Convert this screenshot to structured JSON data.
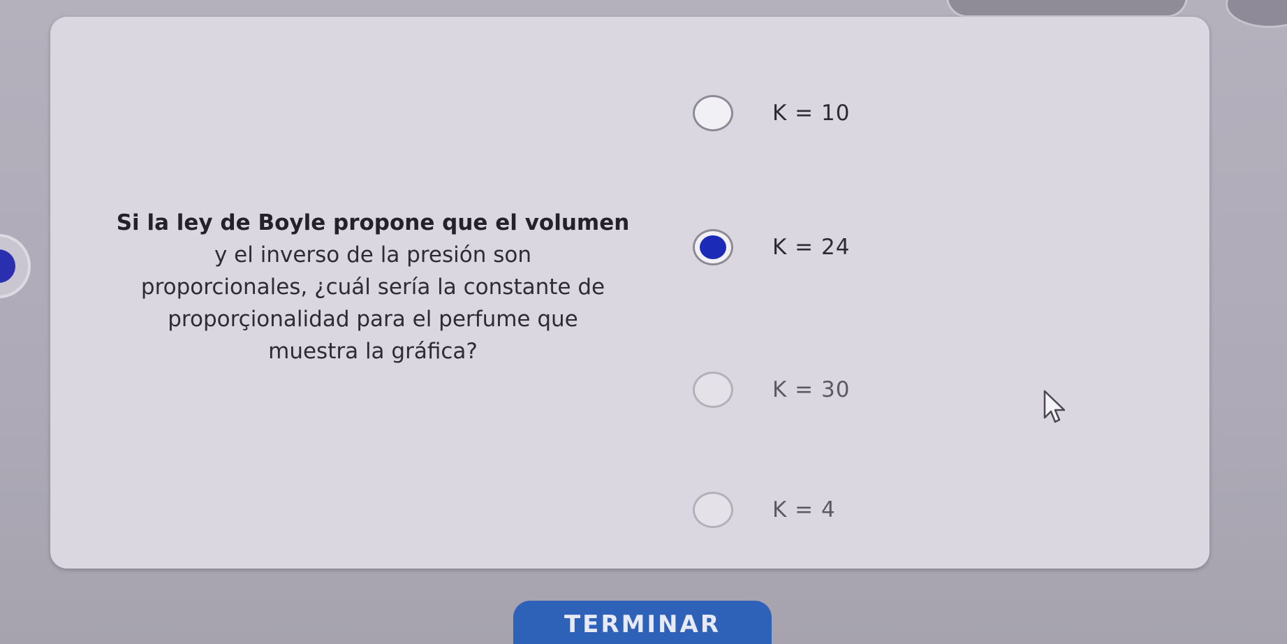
{
  "question": {
    "line_bold": "Si la ley de Boyle propone que el volumen",
    "line2": "y el inverso de la presión son",
    "line3": "proporcionales, ¿cuál sería la constante de",
    "line4": "proporçionalidad para el perfume que",
    "line5": "muestra la gráfica?"
  },
  "options": [
    {
      "label": "K = 10",
      "selected": false
    },
    {
      "label": "K = 24",
      "selected": true
    },
    {
      "label": "K = 30",
      "selected": false
    },
    {
      "label": "K = 4",
      "selected": false
    }
  ],
  "submit_label": "TERMINAR",
  "icons": {
    "cursor": "mouse-pointer-icon",
    "radio": "radio-button-icon"
  },
  "colors": {
    "selected_radio": "#1c2bb7",
    "submit_button": "#2d62b8",
    "card_background": "#dad7e0"
  }
}
